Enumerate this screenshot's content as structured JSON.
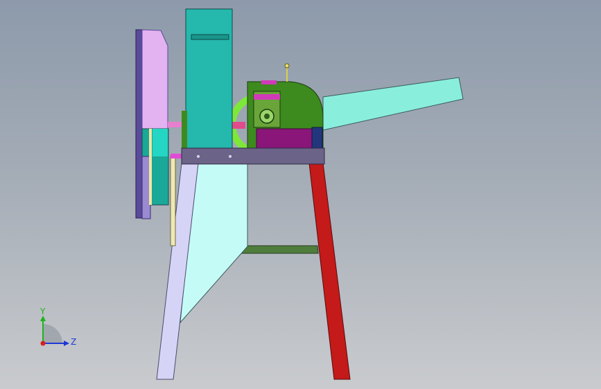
{
  "viewport": {
    "background_top": "#8d9aab",
    "background_bottom": "#c9cbce"
  },
  "model": {
    "description_icon": "chaff-cutter-machine-model",
    "colors": {
      "frame_top": "#6b6388",
      "left_leg": "#d6d4f6",
      "cyan_panel": "#c5fbf6",
      "right_leg": "#c41a1a",
      "crossbar": "#4f7d3c",
      "teal_housing": "#25b8ad",
      "pulley_face": "#e3b2f1",
      "green_gearbox": "#3d8a1f",
      "magenta_block": "#8a167a",
      "blue_block": "#23367d",
      "outlet_chute": "#8aeedd",
      "lime_ring": "#7ee83a"
    }
  },
  "triad": {
    "y_label": "Y",
    "z_label": "Z",
    "y_color": "#1db31d",
    "z_color": "#1f37d6",
    "x_color": "#d61f1f"
  }
}
